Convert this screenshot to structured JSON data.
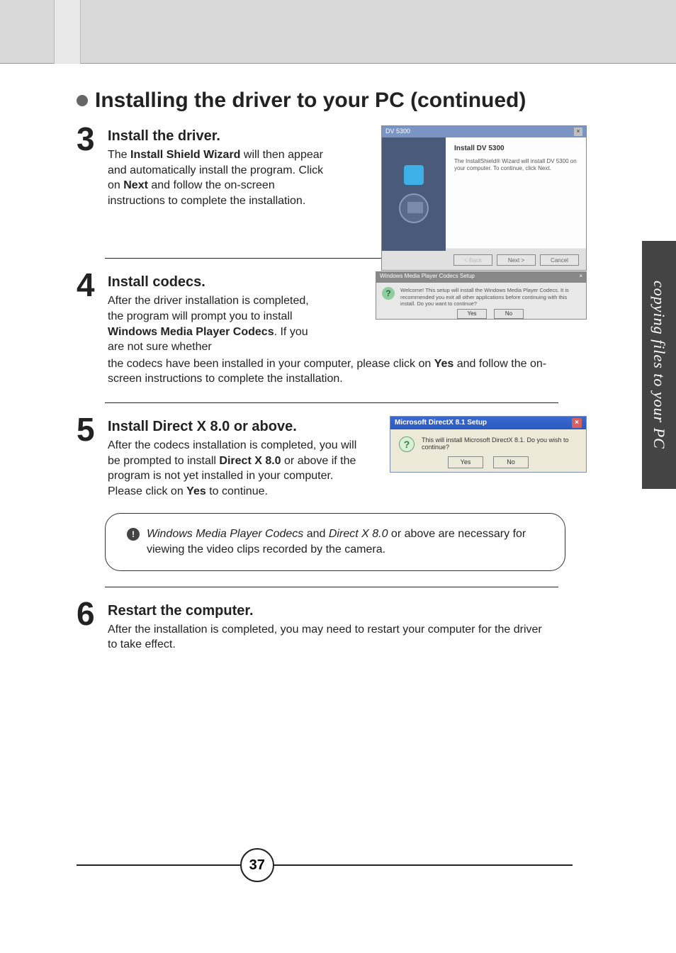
{
  "sideTab": "copying files to your PC",
  "title": "Installing the driver to your PC (continued)",
  "steps": {
    "s3": {
      "num": "3",
      "heading": "Install the driver.",
      "p1": "The ",
      "b1": "Install Shield Wizard",
      "p2": " will then appear and automatically install the program. Click on ",
      "b2": "Next",
      "p3": " and follow the on-screen instructions to complete the installation."
    },
    "s4": {
      "num": "4",
      "heading": "Install codecs.",
      "p1": "After the driver installation is completed, the program will prompt you to install ",
      "b1": "Windows Media Player Codecs",
      "p2": ". If you are not sure whether",
      "p3": "the codecs have been installed in your computer, please click on ",
      "b2": "Yes",
      "p4": " and follow the on-screen instructions to complete the installation."
    },
    "s5": {
      "num": "5",
      "heading": "Install Direct X 8.0 or above.",
      "p1": "After the codecs installation is completed, you will be prompted to install ",
      "b1": "Direct X 8.0",
      "p2": " or above if the program is not yet installed in your computer. Please click on ",
      "b2": "Yes",
      "p3": " to continue."
    },
    "s6": {
      "num": "6",
      "heading": "Restart the computer.",
      "p1": "After the installation is completed, you may need to restart your computer for the driver to take effect."
    }
  },
  "note": {
    "i1": "Windows Media Player Codecs",
    "t1": " and ",
    "i2": "Direct X 8.0",
    "t2": " or above are necessary for viewing the video clips recorded by the camera."
  },
  "dialogs": {
    "d3": {
      "title": "DV 5300",
      "close": "×",
      "heading": "Install DV 5300",
      "sub": "The InstallShield® Wizard will install DV 5300 on your computer. To continue, click Next.",
      "back": "< Back",
      "next": "Next >",
      "cancel": "Cancel"
    },
    "d4": {
      "title": "Windows Media Player Codecs Setup",
      "close": "×",
      "icon": "?",
      "text": "Welcome!  This setup will install the Windows Media Player Codecs.  It is recommended you exit all other applications before continuing with this install.  Do you want to continue?",
      "yes": "Yes",
      "no": "No"
    },
    "d5": {
      "title": "Microsoft DirectX 8.1 Setup",
      "close": "×",
      "icon": "?",
      "text": "This will install Microsoft DirectX 8.1.  Do you wish to continue?",
      "yes": "Yes",
      "no": "No"
    }
  },
  "pageNumber": "37"
}
